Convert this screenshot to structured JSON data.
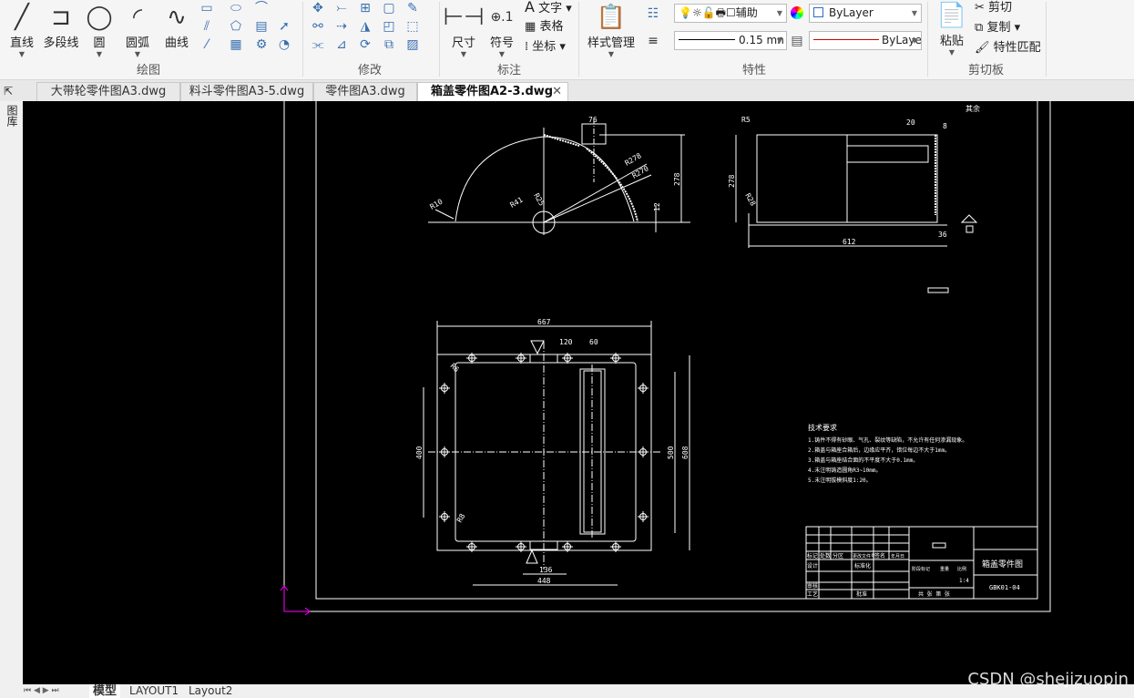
{
  "ribbon": {
    "draw": {
      "label": "绘图",
      "tools": [
        "直线",
        "多段线",
        "圆",
        "圆弧",
        "曲线"
      ]
    },
    "modify": {
      "label": "修改"
    },
    "annotate": {
      "label": "标注",
      "dimension": "尺寸",
      "symbol": "符号",
      "text": "文字",
      "table": "表格",
      "coordinate": "坐标"
    },
    "properties": {
      "label": "特性",
      "style_manager": "样式管理",
      "layer": "辅助",
      "color": "ByLayer",
      "lineweight": "0.15 mn",
      "linetype": "ByLaye"
    },
    "clipboard": {
      "label": "剪切板",
      "paste": "粘贴",
      "cut": "剪切",
      "copy": "复制",
      "match": "特性匹配"
    }
  },
  "file_tabs": [
    {
      "label": "大带轮零件图A3.dwg",
      "active": false
    },
    {
      "label": "料斗零件图A3-5.dwg",
      "active": false
    },
    {
      "label": "零件图A3.dwg",
      "active": false
    },
    {
      "label": "箱盖零件图A2-3.dwg",
      "active": true
    }
  ],
  "left_panel": {
    "label": "图库"
  },
  "drawing": {
    "front_dims": [
      "76",
      "R278",
      "R270",
      "R10",
      "R41",
      "R25",
      "278",
      "12"
    ],
    "side_dims": [
      "R5",
      "20",
      "8",
      "278",
      "R28",
      "612",
      "36"
    ],
    "roughness_note": "其余",
    "top_dims": [
      "667",
      "120",
      "60",
      "R6",
      "400",
      "500",
      "608",
      "R8",
      "136",
      "448"
    ],
    "tech_title": "技术要求",
    "tech_lines": [
      "1.铸件不得有砂眼、气孔、裂纹等缺陷，不允许有任何渗漏现象。",
      "2.箱盖与箱座合箱后，边缘应平齐，错位每边不大于1mm。",
      "3.箱盖与箱座结合面的不平度不大于0.1mm。",
      "4.未注明铸造圆角R3~10mm。",
      "5.未注明拔模斜度1:20。"
    ],
    "title_block": {
      "name": "箱盖零件图",
      "code": "GBK01-04",
      "scale": "1:4",
      "row_labels": [
        "标记",
        "处数",
        "分区",
        "更改文件号",
        "签名",
        "年月日"
      ],
      "roles": [
        "设计",
        "审核",
        "工艺"
      ],
      "std": "标准化",
      "approve": "批准",
      "stage": "阶段标记",
      "weight": "重量",
      "ratio": "比例",
      "sheet": "共 张 第 张"
    }
  },
  "layout_tabs": [
    "模型",
    "LAYOUT1",
    "Layout2"
  ],
  "watermark": "CSDN @shejizuopin",
  "colors": {
    "canvas": "#000000",
    "ucs": "#ff00ff",
    "linetype_sample": "#cc0000"
  }
}
